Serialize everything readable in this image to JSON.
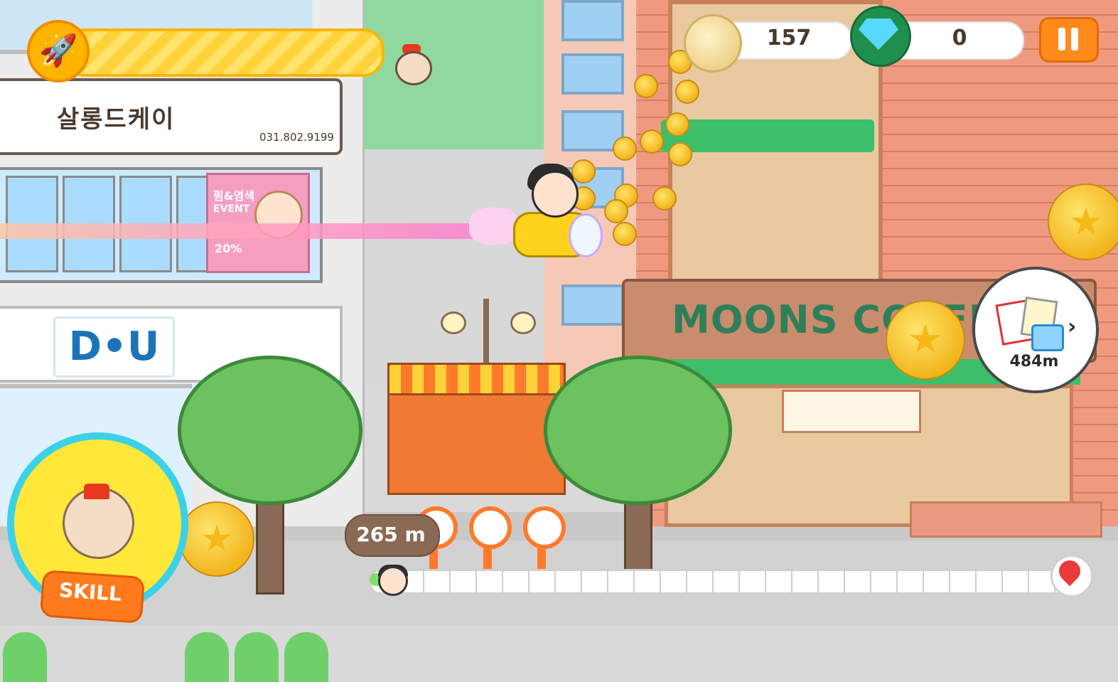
{
  "hud": {
    "coins": "157",
    "gems": "0",
    "pause_icon": "pause-icon",
    "rocket_icon": "rocket-icon",
    "rocket_gauge_fill": 1.0
  },
  "scene": {
    "salon_name": "살롱드케이",
    "salon_phone": "031.802.9199",
    "event_title": "펌&염색",
    "event_sub": "EVENT",
    "event_pct": "20%",
    "du_logo": "D•U",
    "cafe_name": "MOONS COFFEE"
  },
  "progress": {
    "current_distance": "265 m",
    "next_reward_distance": "484m",
    "next_chevron": "›",
    "goal_icon": "star-pin-icon"
  },
  "skill": {
    "label": "SKILL",
    "character_icon": "bird-king-icon"
  },
  "colors": {
    "accent_orange": "#ff8a1c",
    "skill_ring": "#3bd1e8",
    "gauge_yellow": "#ffd84a",
    "cafe_green": "#3cbf68"
  }
}
